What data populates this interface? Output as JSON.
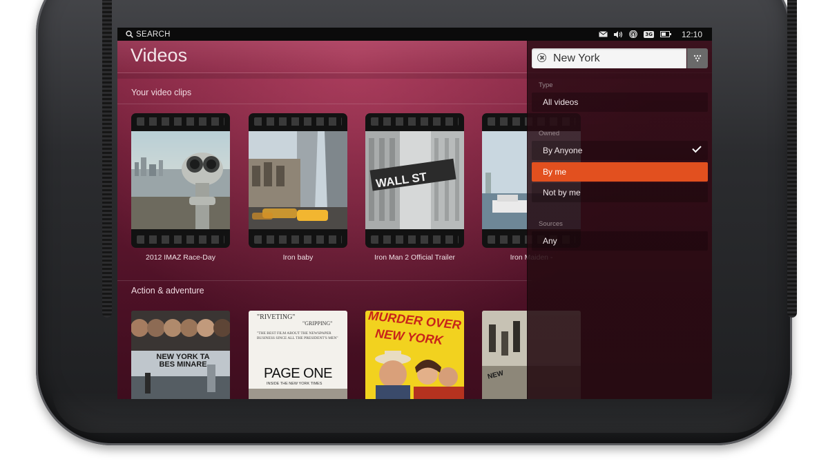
{
  "status_bar": {
    "search_label": "SEARCH",
    "network_badge": "3G",
    "time": "12:10",
    "icons": [
      "search-icon",
      "mail-icon",
      "volume-icon",
      "wifi-icon",
      "network-3g-icon",
      "battery-icon"
    ]
  },
  "app": {
    "title": "Videos",
    "sections": [
      {
        "title": "Your video clips",
        "items": [
          {
            "caption": "2012 IMAZ Race-Day"
          },
          {
            "caption": "Iron baby"
          },
          {
            "caption": "Iron Man 2 Official Trailer"
          },
          {
            "caption": "Iron Maiden -"
          }
        ]
      },
      {
        "title": "Action & adventure",
        "items": [
          {
            "poster_text": "NEW YORK TA BES MINARE"
          },
          {
            "poster_quote_1": "\"RIVETING\"",
            "poster_quote_2": "\"GRIPPING\"",
            "poster_quote_3": "\"THE BEST FILM ABOUT THE NEWSPAPER BUSINESS SINCE ALL THE PRESIDENT'S MEN\"",
            "poster_title": "PAGE ONE",
            "poster_subtitle": "INSIDE THE NEW YORK TIMES"
          },
          {
            "poster_title_1": "MURDER OVER",
            "poster_title_2": "NEW YORK"
          },
          {
            "poster_text": "NEW"
          }
        ]
      }
    ],
    "street_sign": "WALL ST"
  },
  "filter_panel": {
    "search_value": "New York",
    "groups": [
      {
        "label": "Type",
        "options": [
          {
            "label": "All videos",
            "selected": false,
            "checked": false
          }
        ]
      },
      {
        "label": "Owned",
        "options": [
          {
            "label": "By Anyone",
            "selected": false,
            "checked": true
          },
          {
            "label": "By me",
            "selected": true,
            "checked": false
          },
          {
            "label": "Not by me",
            "selected": false,
            "checked": false
          }
        ]
      },
      {
        "label": "Sources",
        "options": [
          {
            "label": "Any",
            "selected": false,
            "checked": false
          }
        ]
      }
    ]
  },
  "colors": {
    "accent": "#e2501f",
    "app_background": "#6b1c35",
    "status_bar": "#0b0b0b"
  }
}
